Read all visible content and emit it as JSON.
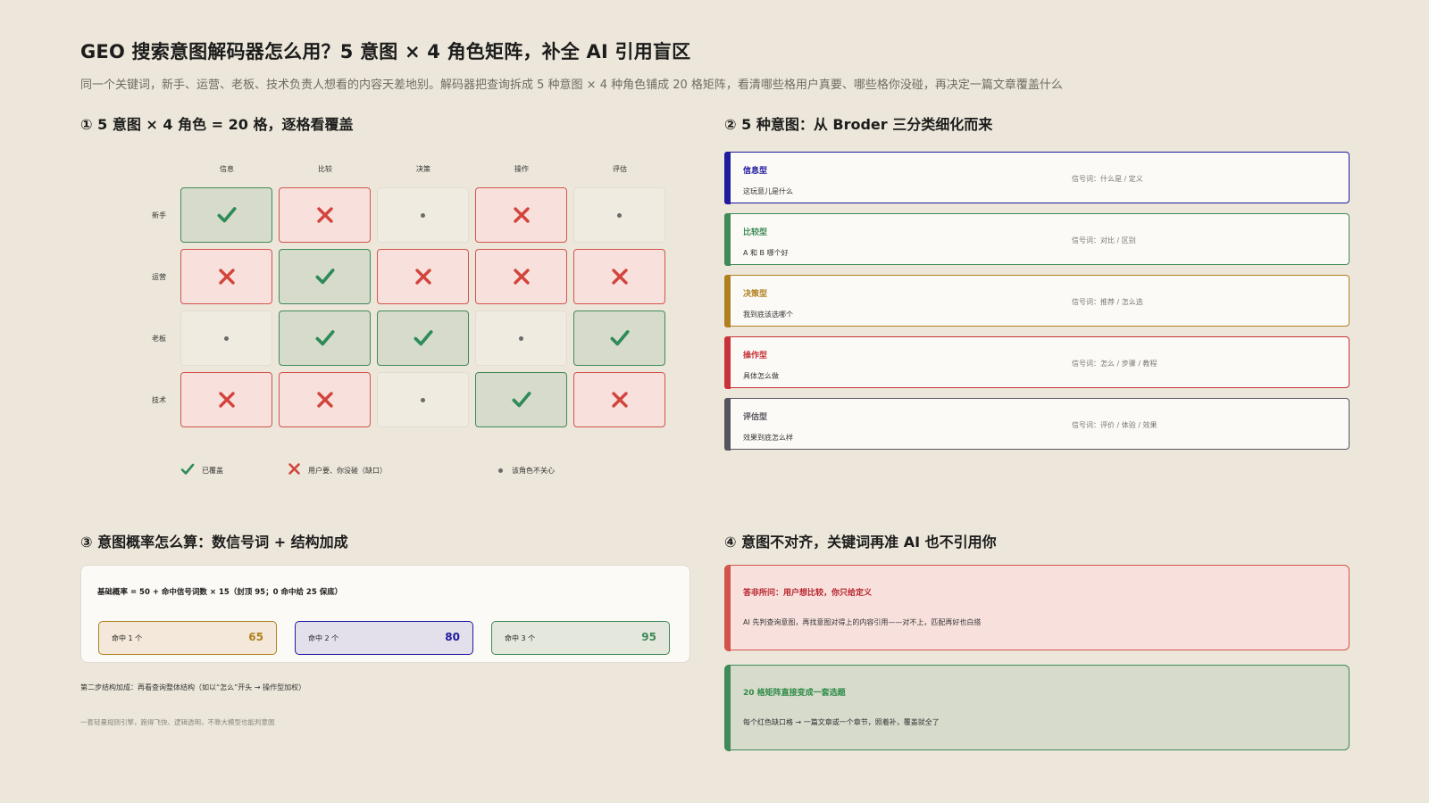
{
  "header": {
    "title": "GEO 搜索意图解码器怎么用？5 意图 × 4 角色矩阵，补全 AI 引用盲区",
    "subtitle": "同一个关键词，新手、运营、老板、技术负责人想看的内容天差地别。解码器把查询拆成 5 种意图 × 4 种角色铺成 20 格矩阵，看清哪些格用户真要、哪些格你没碰，再决定一篇文章覆盖什么"
  },
  "section1": {
    "title": "① 5 意图 × 4 角色 = 20 格，逐格看覆盖",
    "columns": [
      "信息",
      "比较",
      "决策",
      "操作",
      "评估"
    ],
    "rows": [
      {
        "label": "新手",
        "cells": [
          "yes",
          "no",
          "na",
          "no",
          "na"
        ]
      },
      {
        "label": "运营",
        "cells": [
          "no",
          "yes",
          "no",
          "no",
          "no"
        ]
      },
      {
        "label": "老板",
        "cells": [
          "na",
          "yes",
          "yes",
          "na",
          "yes"
        ]
      },
      {
        "label": "技术",
        "cells": [
          "no",
          "no",
          "na",
          "yes",
          "no"
        ]
      }
    ],
    "legend": {
      "yes": "已覆盖",
      "no": "用户要、你没碰（缺口）",
      "na": "该角色不关心"
    },
    "colors": {
      "yes": "#2E8B57",
      "no": "#D2443C",
      "na": "#6a6a6a"
    }
  },
  "section2": {
    "title": "② 5 种意图：从 Broder 三分类细化而来",
    "intents": [
      {
        "name": "信息型",
        "desc": "这玩意儿是什么",
        "signal": "信号词：什么是 / 定义",
        "color": "#1F1A9E"
      },
      {
        "name": "比较型",
        "desc": "A 和 B 哪个好",
        "signal": "信号词：对比 / 区别",
        "color": "#3F8A58"
      },
      {
        "name": "决策型",
        "desc": "我到底该选哪个",
        "signal": "信号词：推荐 / 怎么选",
        "color": "#B0801F"
      },
      {
        "name": "操作型",
        "desc": "具体怎么做",
        "signal": "信号词：怎么 / 步骤 / 教程",
        "color": "#C8323A"
      },
      {
        "name": "评估型",
        "desc": "效果到底怎么样",
        "signal": "信号词：评价 / 体验 / 效果",
        "color": "#55545E"
      }
    ]
  },
  "section3": {
    "title": "③ 意图概率怎么算：数信号词 + 结构加成",
    "formula": "基础概率 = 50 + 命中信号词数 × 15（封顶 95；0 命中给 25 保底）",
    "hits": [
      {
        "label": "命中 1 个",
        "value": "65",
        "color": "#B0801F",
        "bg": "#F3E8DA"
      },
      {
        "label": "命中 2 个",
        "value": "80",
        "color": "#1F1A9E",
        "bg": "#E3E0EB"
      },
      {
        "label": "命中 3 个",
        "value": "95",
        "color": "#3F8A58",
        "bg": "#E4E7DC"
      }
    ],
    "note1": "第二步结构加成：再看查询整体结构（如以“怎么”开头 → 操作型加权）",
    "note2": "一套轻量规则引擎，跑得飞快、逻辑透明，不靠大模型也能判意图"
  },
  "section4": {
    "title": "④ 意图不对齐，关键词再准 AI 也不引用你",
    "cards": [
      {
        "title": "答非所问：用户想比较，你只给定义",
        "body": "AI 先判查询意图，再找意图对得上的内容引用——对不上，匹配再好也白搭",
        "color": "#B8232D",
        "bg": "#F8E1DD",
        "border": "#D2544C"
      },
      {
        "title": "20 格矩阵直接变成一套选题",
        "body": "每个红色缺口格 → 一篇文章或一个章节，照着补，覆盖就全了",
        "color": "#2E8B47",
        "bg": "#D7DBCC",
        "border": "#3F8A58"
      }
    ]
  }
}
